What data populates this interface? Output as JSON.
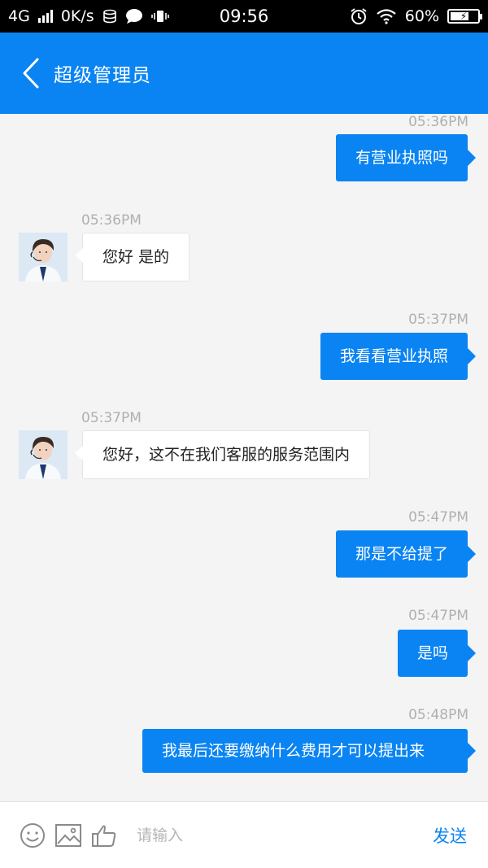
{
  "status_bar": {
    "network": "4G",
    "speed": "0K/s",
    "time": "09:56",
    "battery": "60%"
  },
  "header": {
    "title": "超级管理员"
  },
  "messages": [
    {
      "sender": "me",
      "time": "05:36PM",
      "text": "有营业执照吗"
    },
    {
      "sender": "them",
      "time": "05:36PM",
      "text": "您好 是的"
    },
    {
      "sender": "me",
      "time": "05:37PM",
      "text": "我看看营业执照"
    },
    {
      "sender": "them",
      "time": "05:37PM",
      "text": "您好，这不在我们客服的服务范围内"
    },
    {
      "sender": "me",
      "time": "05:47PM",
      "text": "那是不给提了"
    },
    {
      "sender": "me",
      "time": "05:47PM",
      "text": "是吗"
    },
    {
      "sender": "me",
      "time": "05:48PM",
      "text": "我最后还要缴纳什么费用才可以提出来"
    }
  ],
  "input_bar": {
    "placeholder": "请输入",
    "send_label": "发送",
    "icons": [
      "emoji-icon",
      "image-icon",
      "thumbs-up-icon"
    ]
  },
  "colors": {
    "accent": "#0a84f2",
    "background": "#f4f4f4",
    "status_bar": "#000000",
    "timestamp": "#b0b0b0"
  }
}
